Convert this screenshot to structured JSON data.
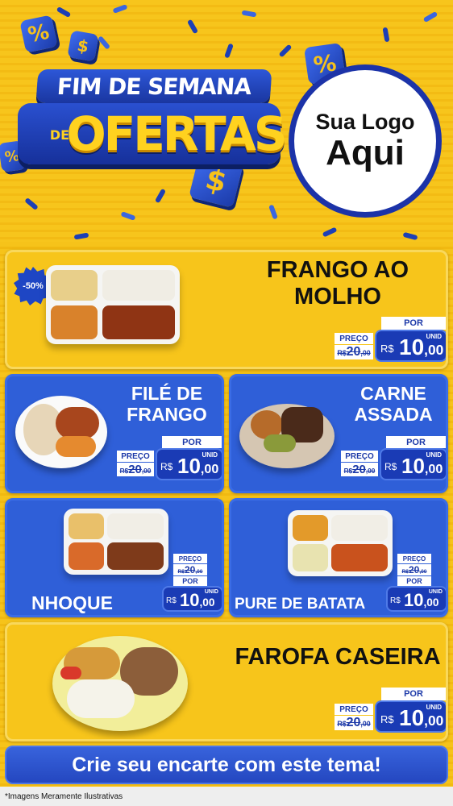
{
  "header": {
    "title_line1": "FIM DE SEMANA",
    "title_de": "DE",
    "title_line2": "OFERTAS",
    "logo_line1": "Sua Logo",
    "logo_line2": "Aqui",
    "cube_symbols": [
      "%",
      "$",
      "$",
      "%",
      "%"
    ]
  },
  "colors": {
    "brand_blue": "#1d3aa9",
    "brand_yellow": "#f7c51b",
    "card_blue": "#2f5fd8"
  },
  "items": [
    {
      "name_line1": "FRANGO AO",
      "name_line2": "MOLHO",
      "discount": "-50%",
      "preco_label": "PREÇO",
      "old_rs": "R$",
      "old_int": "20",
      "old_dec": ",00",
      "por_label": "POR",
      "unid": "UNID",
      "rs": "R$",
      "price_int": "10",
      "price_dec": ",00"
    },
    {
      "name_line1": "FILÉ DE",
      "name_line2": "FRANGO",
      "preco_label": "PREÇO",
      "old_rs": "R$",
      "old_int": "20",
      "old_dec": ",00",
      "por_label": "POR",
      "unid": "UNID",
      "rs": "R$",
      "price_int": "10",
      "price_dec": ",00"
    },
    {
      "name_line1": "CARNE",
      "name_line2": "ASSADA",
      "preco_label": "PREÇO",
      "old_rs": "R$",
      "old_int": "20",
      "old_dec": ",00",
      "por_label": "POR",
      "unid": "UNID",
      "rs": "R$",
      "price_int": "10",
      "price_dec": ",00"
    },
    {
      "name_line1": "NHOQUE",
      "preco_label": "PREÇO",
      "old_rs": "R$",
      "old_int": "20",
      "old_dec": ",00",
      "por_label": "POR",
      "unid": "UNID",
      "rs": "R$",
      "price_int": "10",
      "price_dec": ",00"
    },
    {
      "name_line1": "PURE DE BATATA",
      "preco_label": "PREÇO",
      "old_rs": "R$",
      "old_int": "20",
      "old_dec": ",00",
      "por_label": "POR",
      "unid": "UNID",
      "rs": "R$",
      "price_int": "10",
      "price_dec": ",00"
    },
    {
      "name_line1": "FAROFA CASEIRA",
      "preco_label": "PREÇO",
      "old_rs": "R$",
      "old_int": "20",
      "old_dec": ",00",
      "por_label": "POR",
      "unid": "UNID",
      "rs": "R$",
      "price_int": "10",
      "price_dec": ",00"
    }
  ],
  "cta": "Crie seu encarte com este tema!",
  "footer_note": "*Imagens Meramente Ilustrativas"
}
